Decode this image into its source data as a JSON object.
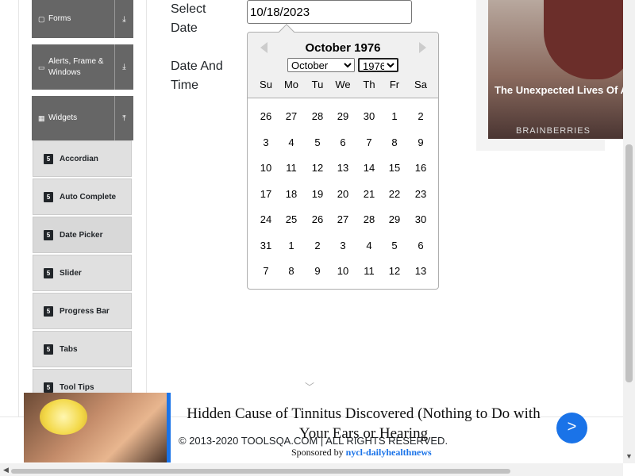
{
  "sidebar": {
    "groups": [
      {
        "label": "Forms",
        "icon": "file-icon"
      },
      {
        "label": "Alerts, Frame & Windows",
        "icon": "window-icon"
      },
      {
        "label": "Widgets",
        "icon": "grid-icon"
      }
    ],
    "items": [
      {
        "label": "Accordian"
      },
      {
        "label": "Auto Complete"
      },
      {
        "label": "Date Picker"
      },
      {
        "label": "Slider"
      },
      {
        "label": "Progress Bar"
      },
      {
        "label": "Tabs"
      },
      {
        "label": "Tool Tips"
      }
    ]
  },
  "form": {
    "select_date_label": "Select Date",
    "date_and_time_label": "Date And Time",
    "date_value": "10/18/2023"
  },
  "datepicker": {
    "current_month": "October 1976",
    "month_select": "October",
    "year_select": "1976",
    "weekdays": [
      "Su",
      "Mo",
      "Tu",
      "We",
      "Th",
      "Fr",
      "Sa"
    ],
    "weeks": [
      [
        "26",
        "27",
        "28",
        "29",
        "30",
        "1",
        "2"
      ],
      [
        "3",
        "4",
        "5",
        "6",
        "7",
        "8",
        "9"
      ],
      [
        "10",
        "11",
        "12",
        "13",
        "14",
        "15",
        "16"
      ],
      [
        "17",
        "18",
        "19",
        "20",
        "21",
        "22",
        "23"
      ],
      [
        "24",
        "25",
        "26",
        "27",
        "28",
        "29",
        "30"
      ],
      [
        "31",
        "1",
        "2",
        "3",
        "4",
        "5",
        "6"
      ],
      [
        "7",
        "8",
        "9",
        "10",
        "11",
        "12",
        "13"
      ]
    ]
  },
  "ad_right": {
    "title": "The Unexpected Lives Of Actors Who Left The Industry",
    "brand": "BRAINBERRIES"
  },
  "footer": {
    "copyright": "© 2013-2020 TOOLSQA.COM | ALL RIGHTS RESERVED."
  },
  "ad_bottom": {
    "headline": "Hidden Cause of Tinnitus Discovered (Nothing to Do with Your Ears or Hearing",
    "sponsored_prefix": "Sponsored by",
    "sponsor": "nycl-dailyhealthnews",
    "go_label": ">"
  }
}
